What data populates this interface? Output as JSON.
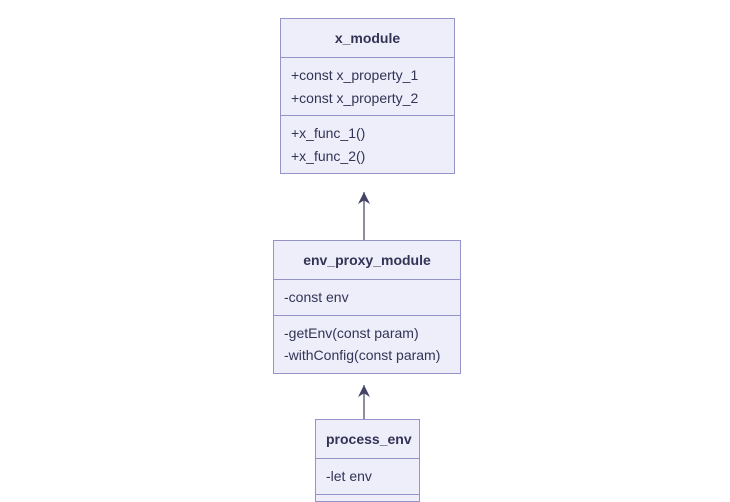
{
  "diagram": {
    "type": "uml_class_diagram",
    "classes": [
      {
        "id": "x_module",
        "title": "x_module",
        "attributes": [
          "+const x_property_1",
          "+const x_property_2"
        ],
        "methods": [
          "+x_func_1()",
          "+x_func_2()"
        ]
      },
      {
        "id": "env_proxy_module",
        "title": "env_proxy_module",
        "attributes": [
          "-const env"
        ],
        "methods": [
          "-getEnv(const param)",
          "-withConfig(const param)"
        ]
      },
      {
        "id": "process_env",
        "title": "process_env",
        "attributes": [
          "-let env"
        ],
        "methods": []
      }
    ],
    "relations": [
      {
        "from": "env_proxy_module",
        "to": "x_module",
        "type": "depends"
      },
      {
        "from": "process_env",
        "to": "env_proxy_module",
        "type": "depends"
      }
    ]
  },
  "colors": {
    "box_fill": "#eeeefb",
    "box_stroke": "#9494c8",
    "text": "#333355",
    "arrow": "#444466"
  }
}
